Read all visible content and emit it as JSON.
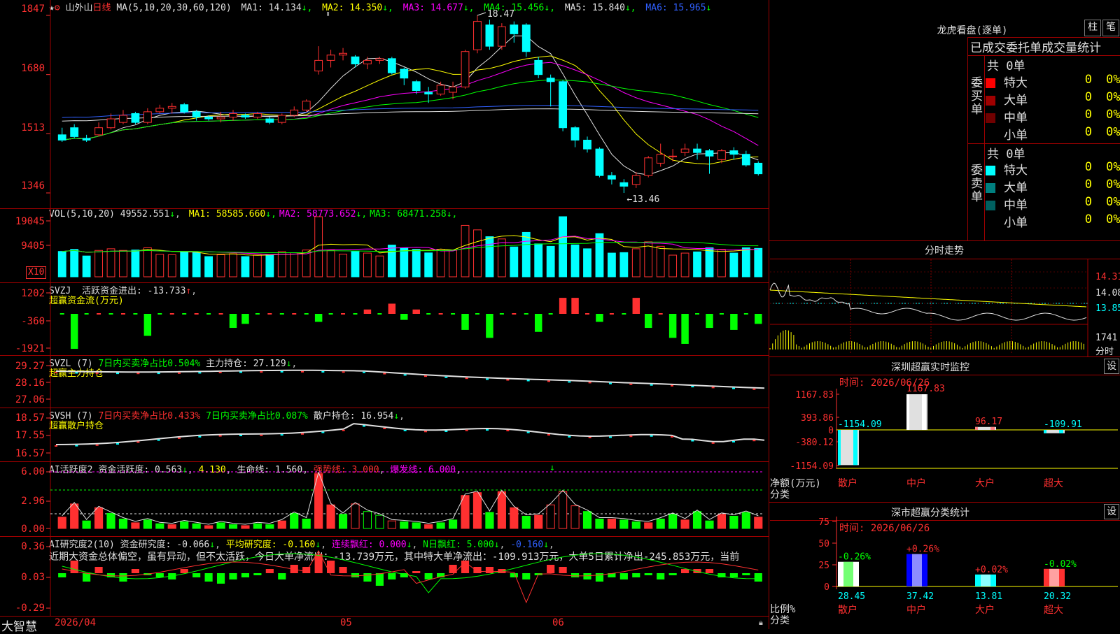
{
  "app": {
    "name": "大智慧",
    "date_label": "2026/04",
    "month_5": "05",
    "month_6": "06"
  },
  "kline": {
    "stock": "山外山",
    "period": "日线",
    "ma_label": "MA(5,10,20,30,60,120)",
    "ma": [
      {
        "label": "MA1:",
        "value": "14.134",
        "arrow": "↓",
        "color": "#e0e0e0"
      },
      {
        "label": "MA2:",
        "value": "14.350",
        "arrow": "↓",
        "color": "#ffff00"
      },
      {
        "label": "MA3:",
        "value": "14.677",
        "arrow": "↓",
        "color": "#ff00ff"
      },
      {
        "label": "MA4:",
        "value": "15.456",
        "arrow": "↓",
        "color": "#00ff00"
      },
      {
        "label": "MA5:",
        "value": "15.840",
        "arrow": "↓",
        "color": "#e0e0e0"
      },
      {
        "label": "MA6:",
        "value": "15.965",
        "arrow": "↓",
        "color": "#3060ff"
      }
    ],
    "y_ticks": [
      "1847",
      "1680",
      "1513",
      "1346"
    ],
    "high_label": "18.47",
    "low_label": "←13.46",
    "candles": [
      [
        15.1,
        14.95,
        14.9,
        15.3
      ],
      [
        15.3,
        15.05,
        15.0,
        15.4
      ],
      [
        15.0,
        14.95,
        14.9,
        15.1
      ],
      [
        15.1,
        15.3,
        15.05,
        15.45
      ],
      [
        15.3,
        15.55,
        15.25,
        15.7
      ],
      [
        15.45,
        15.65,
        15.4,
        15.8
      ],
      [
        15.7,
        15.45,
        15.4,
        15.75
      ],
      [
        15.45,
        15.75,
        15.4,
        15.85
      ],
      [
        15.75,
        15.85,
        15.7,
        15.95
      ],
      [
        15.85,
        15.9,
        15.7,
        16.0
      ],
      [
        15.95,
        15.75,
        15.7,
        16.0
      ],
      [
        15.75,
        15.6,
        15.5,
        15.8
      ],
      [
        15.6,
        15.55,
        15.5,
        15.65
      ],
      [
        15.55,
        15.6,
        15.45,
        15.75
      ],
      [
        15.6,
        15.7,
        15.5,
        15.8
      ],
      [
        15.65,
        15.6,
        15.55,
        15.7
      ],
      [
        15.6,
        15.7,
        15.55,
        15.75
      ],
      [
        15.55,
        15.45,
        15.4,
        15.6
      ],
      [
        15.45,
        15.65,
        15.4,
        15.7
      ],
      [
        15.65,
        15.8,
        15.6,
        15.9
      ],
      [
        15.8,
        16.05,
        15.75,
        16.1
      ],
      [
        16.9,
        17.2,
        16.8,
        17.6
      ],
      [
        17.2,
        17.35,
        17.0,
        17.5
      ],
      [
        17.35,
        17.4,
        17.2,
        17.55
      ],
      [
        17.3,
        17.1,
        17.0,
        17.35
      ],
      [
        17.1,
        17.2,
        16.95,
        17.3
      ],
      [
        17.2,
        17.25,
        17.1,
        17.3
      ],
      [
        17.25,
        16.85,
        16.8,
        17.3
      ],
      [
        16.95,
        16.7,
        16.5,
        17.0
      ],
      [
        16.6,
        16.35,
        16.25,
        16.65
      ],
      [
        16.3,
        16.25,
        16.0,
        16.45
      ],
      [
        16.25,
        16.5,
        16.2,
        16.6
      ],
      [
        16.3,
        16.45,
        16.1,
        16.6
      ],
      [
        16.45,
        17.45,
        16.4,
        17.5
      ],
      [
        17.5,
        18.3,
        17.4,
        18.47
      ],
      [
        18.2,
        17.6,
        17.5,
        18.35
      ],
      [
        17.6,
        18.15,
        17.5,
        18.25
      ],
      [
        18.2,
        17.95,
        17.7,
        18.3
      ],
      [
        18.2,
        17.45,
        17.3,
        18.25
      ],
      [
        17.2,
        16.8,
        16.7,
        17.3
      ],
      [
        16.7,
        16.6,
        15.9,
        16.8
      ],
      [
        16.6,
        15.3,
        15.2,
        16.65
      ],
      [
        15.3,
        14.95,
        14.75,
        15.35
      ],
      [
        14.95,
        14.7,
        14.6,
        15.05
      ],
      [
        14.7,
        13.95,
        13.9,
        14.75
      ],
      [
        13.95,
        13.85,
        13.7,
        14.05
      ],
      [
        13.75,
        13.65,
        13.46,
        13.85
      ],
      [
        13.7,
        13.95,
        13.6,
        14.05
      ],
      [
        13.95,
        14.45,
        13.9,
        14.5
      ],
      [
        14.3,
        14.55,
        14.2,
        14.85
      ],
      [
        14.5,
        14.5,
        14.35,
        14.7
      ],
      [
        14.6,
        14.7,
        14.5,
        14.85
      ],
      [
        14.7,
        14.6,
        14.4,
        14.85
      ],
      [
        14.65,
        14.5,
        14.0,
        14.7
      ],
      [
        14.4,
        14.65,
        14.3,
        14.7
      ],
      [
        14.65,
        14.55,
        14.4,
        14.75
      ],
      [
        14.55,
        14.25,
        14.2,
        14.65
      ],
      [
        14.3,
        14.0,
        13.95,
        14.35
      ]
    ]
  },
  "vol": {
    "label": "VOL(5,10,20)",
    "value": "49552.551",
    "arrow": "↓",
    "ma": [
      {
        "label": "MA1:",
        "value": "58585.660",
        "arrow": "↓",
        "color": "#ffff00"
      },
      {
        "label": "MA2:",
        "value": "58773.652",
        "arrow": "↓",
        "color": "#ff00ff"
      },
      {
        "label": "MA3:",
        "value": "68471.258",
        "arrow": "↓",
        "color": "#00ff00"
      }
    ],
    "y_ticks": [
      "19045",
      "9405"
    ],
    "unit": "X10"
  },
  "svzj": {
    "name": "SVZJ",
    "label": "活跃资金进出:",
    "value": "-13.733",
    "arrow": "↑",
    "sub": "超赢资金流(万元)",
    "y_ticks": [
      "1202",
      "-360",
      "-1921"
    ]
  },
  "svzl": {
    "name": "SVZL (7)",
    "t1": "7日内买卖净占比0.504%",
    "t2": "主力持仓:",
    "value": "27.129",
    "arrow": "↓",
    "sub": "超赢主力持仓",
    "y_ticks": [
      "29.27",
      "28.16",
      "27.06"
    ]
  },
  "svsh": {
    "name": "SVSH (7)",
    "t1": "7日内买卖净占比0.433%",
    "t2": "7日内买卖净占比0.087%",
    "t3": "散户持仓:",
    "value": "16.954",
    "arrow": "↓",
    "sub": "超赢散户持仓",
    "y_ticks": [
      "18.57",
      "17.55",
      "16.57"
    ]
  },
  "ai1": {
    "name": "AI活跃度2",
    "t1": "资金活跃度:",
    "v1": "0.563",
    "a1": "↓",
    "v2": "4.130",
    "t2": "生命线:",
    "v3": "1.560",
    "t3": "强势线:",
    "v4": "3.000",
    "t4": "爆发线:",
    "v5": "6.000",
    "y_ticks": [
      "6.00",
      "2.96",
      "0.00"
    ]
  },
  "ai2": {
    "name": "AI研究度2(10)",
    "t1": "资金研究度:",
    "v1": "-0.066",
    "a1": "↓",
    "t2": "平均研究度:",
    "v2": "-0.160",
    "a2": "↓",
    "t3": "连续飘红:",
    "v3": "0.000",
    "a3": "↓",
    "t4": "N日飘红:",
    "v4": "5.000",
    "a4": "↓",
    "v5": "-0.160",
    "a5": "↓",
    "text": "近期大资金总体偏空，虽有异动，但不太活跃，今日大单净流出：-13.739万元，其中特大单净流出：-109.913万元，大单5日累计净出-245.853万元，当前",
    "y_ticks": [
      "0.36",
      "0.03",
      "-0.29"
    ]
  },
  "lhb": {
    "title": "龙虎看盘(逐单)",
    "btn1": "柱",
    "btn2": "笔",
    "header": "已成交委托单成交量统计",
    "buy_label": "委买单",
    "sell_label": "委卖单",
    "buy_total": "共 0单",
    "sell_total": "共 0单",
    "buy_rows": [
      {
        "name": "特大",
        "count": "0",
        "pct": "0%",
        "color": "#ff0000"
      },
      {
        "name": "大单",
        "count": "0",
        "pct": "0%",
        "color": "#a00000"
      },
      {
        "name": "中单",
        "count": "0",
        "pct": "0%",
        "color": "#700000"
      },
      {
        "name": "小单",
        "count": "0",
        "pct": "0%",
        "color": "#000000"
      }
    ],
    "sell_rows": [
      {
        "name": "特大",
        "count": "0",
        "pct": "0%",
        "color": "#00ffff"
      },
      {
        "name": "大单",
        "count": "0",
        "pct": "0%",
        "color": "#008080"
      },
      {
        "name": "中单",
        "count": "0",
        "pct": "0%",
        "color": "#006060"
      },
      {
        "name": "小单",
        "count": "0",
        "pct": "0%",
        "color": "#000000"
      }
    ]
  },
  "fenshi": {
    "title": "分时走势",
    "y_ticks": [
      "14.31",
      "14.08",
      "13.85"
    ],
    "vol_label": "1741",
    "vol_unit": "分时"
  },
  "szmon": {
    "title": "深圳超赢实时监控",
    "btn": "设",
    "time": "时间: 2026/06/26",
    "y_ticks": [
      "1167.83",
      "393.86",
      "0",
      "-380.12",
      "-1154.09"
    ],
    "axis_name": "净额(万元)",
    "axis_name2": "分类",
    "cats": [
      {
        "name": "散户",
        "value": "-1154.09",
        "v": -1154.09
      },
      {
        "name": "中户",
        "value": "1167.83",
        "v": 1167.83
      },
      {
        "name": "大户",
        "value": "96.17",
        "v": 96.17
      },
      {
        "name": "超大",
        "value": "-109.91",
        "v": -109.91
      }
    ]
  },
  "szstat": {
    "title": "深市超赢分类统计",
    "btn": "设",
    "time": "时间: 2026/06/26",
    "y_ticks": [
      "75",
      "50",
      "25",
      "0"
    ],
    "axis_name": "比例%",
    "axis_name2": "分类",
    "cats": [
      {
        "name": "散户",
        "value": "28.45",
        "change": "-0.26%",
        "v": 28.45
      },
      {
        "name": "中户",
        "value": "37.42",
        "change": "+0.26%",
        "v": 37.42
      },
      {
        "name": "大户",
        "value": "13.81",
        "change": "+0.02%",
        "v": 13.81
      },
      {
        "name": "超大",
        "value": "20.32",
        "change": "-0.02%",
        "v": 20.32
      }
    ]
  }
}
